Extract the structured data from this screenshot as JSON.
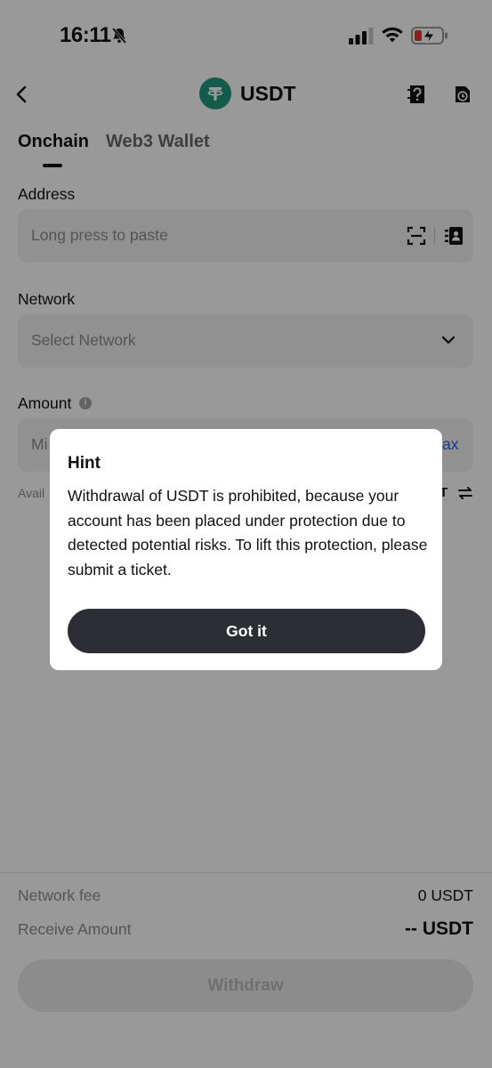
{
  "status_bar": {
    "time": "16:11",
    "icons": [
      "bell-slash-icon",
      "signal-icon",
      "wifi-icon",
      "battery-charging-icon"
    ]
  },
  "header": {
    "title": "USDT",
    "coin_symbol": "₮",
    "coin_color": "#1e9a7a",
    "icons": [
      "back-icon",
      "help-ticket-icon",
      "history-icon"
    ]
  },
  "tabs": [
    {
      "label": "Onchain",
      "active": true
    },
    {
      "label": "Web3 Wallet",
      "active": false
    }
  ],
  "form": {
    "address": {
      "label": "Address",
      "placeholder": "Long press to paste",
      "icons": [
        "scan-icon",
        "address-book-icon"
      ]
    },
    "network": {
      "label": "Network",
      "placeholder": "Select Network",
      "icons": [
        "chevron-down-icon"
      ]
    },
    "amount": {
      "label": "Amount",
      "placeholder_visible": "Mi",
      "max_visible": "ax",
      "available_visible": "Avail",
      "unit_visible": "T"
    }
  },
  "footer": {
    "network_fee_label": "Network fee",
    "network_fee_value": "0 USDT",
    "receive_label": "Receive Amount",
    "receive_value": "-- USDT",
    "withdraw_button": "Withdraw"
  },
  "modal": {
    "title": "Hint",
    "body": "Withdrawal of USDT is prohibited, because your account has been placed under protection due to detected potential risks. To lift this protection, please submit a ticket.",
    "button": "Got it"
  },
  "colors": {
    "overlay": "rgba(0,0,0,0.40)",
    "primary_button": "#2d2e33",
    "link": "#2a5fe0",
    "field_bg": "#f2f2f3"
  }
}
